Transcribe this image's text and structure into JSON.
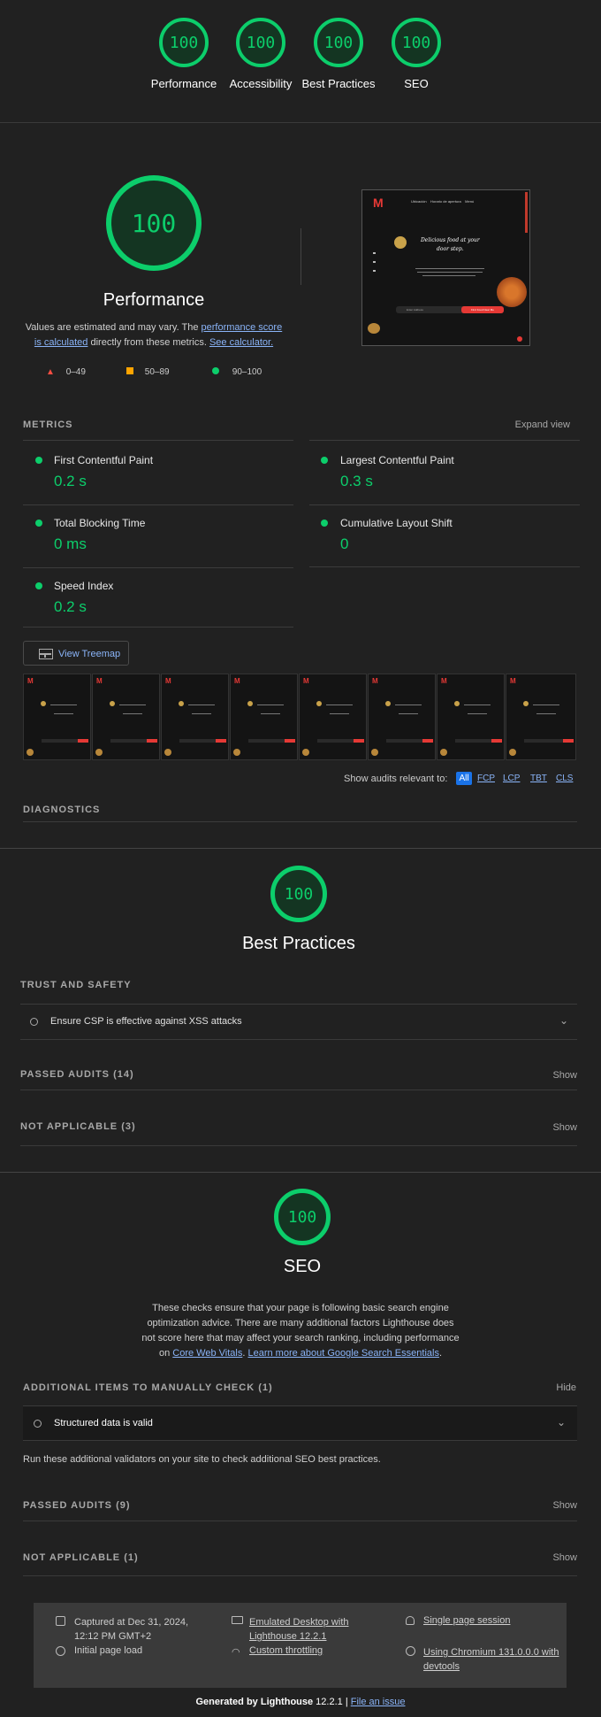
{
  "top_scores": [
    {
      "score": "100",
      "label": "Performance"
    },
    {
      "score": "100",
      "label": "Accessibility"
    },
    {
      "score": "100",
      "label": "Best Practices"
    },
    {
      "score": "100",
      "label": "SEO"
    }
  ],
  "performance": {
    "score": "100",
    "title": "Performance",
    "note_prefix": "Values are estimated and may vary. The ",
    "note_link1": "performance score is calculated",
    "note_mid": " directly from these metrics. ",
    "note_link2": "See calculator.",
    "legend": [
      "0–49",
      "50–89",
      "90–100"
    ],
    "metrics_label": "METRICS",
    "expand_label": "Expand view",
    "metrics": [
      {
        "name": "First Contentful Paint",
        "value": "0.2 s"
      },
      {
        "name": "Largest Contentful Paint",
        "value": "0.3 s"
      },
      {
        "name": "Total Blocking Time",
        "value": "0 ms"
      },
      {
        "name": "Cumulative Layout Shift",
        "value": "0"
      },
      {
        "name": "Speed Index",
        "value": "0.2 s"
      }
    ],
    "treemap_label": "View Treemap",
    "filter_label": "Show audits relevant to:",
    "filters": [
      "All",
      "FCP",
      "LCP",
      "TBT",
      "CLS"
    ],
    "diagnostics_label": "DIAGNOSTICS"
  },
  "preview": {
    "nav": [
      "Ubicación",
      "Horario de apertura",
      "Menú"
    ],
    "headline": "Delicious food at your",
    "headline2": "door step.",
    "search_placeholder": "Enter Address",
    "cta": "Find Food Near Me"
  },
  "best_practices": {
    "score": "100",
    "title": "Best Practices",
    "trust_label": "TRUST AND SAFETY",
    "audit": "Ensure CSP is effective against XSS attacks",
    "passed_label": "PASSED AUDITS (14)",
    "na_label": "NOT APPLICABLE (3)",
    "show": "Show"
  },
  "seo": {
    "score": "100",
    "title": "SEO",
    "desc": "These checks ensure that your page is following basic search engine optimization advice. There are many additional factors Lighthouse does not score here that may affect your search ranking, including performance on ",
    "link1": "Core Web Vitals",
    "sep": ". ",
    "link2": "Learn more about Google Search Essentials",
    "end": ".",
    "manual_label": "ADDITIONAL ITEMS TO MANUALLY CHECK (1)",
    "hide": "Hide",
    "manual_audit": "Structured data is valid",
    "validators": "Run these additional validators on your site to check additional SEO best practices.",
    "passed_label": "PASSED AUDITS (9)",
    "na_label": "NOT APPLICABLE (1)",
    "show": "Show"
  },
  "footer": {
    "captured": "Captured at Dec 31, 2024, 12:12 PM GMT+2",
    "initial": "Initial page load",
    "emulated": "Emulated Desktop with Lighthouse 12.2.1",
    "throttling": "Custom throttling",
    "session": "Single page session",
    "chromium": "Using Chromium 131.0.0.0 with devtools",
    "generated_prefix": "Generated by ",
    "generated_brand": "Lighthouse",
    "generated_version": " 12.2.1 | ",
    "file_issue": "File an issue"
  },
  "colors": {
    "pass": "#0cce6b",
    "average": "#ffa400",
    "fail": "#ff4e42",
    "link": "#8ab4f8"
  }
}
